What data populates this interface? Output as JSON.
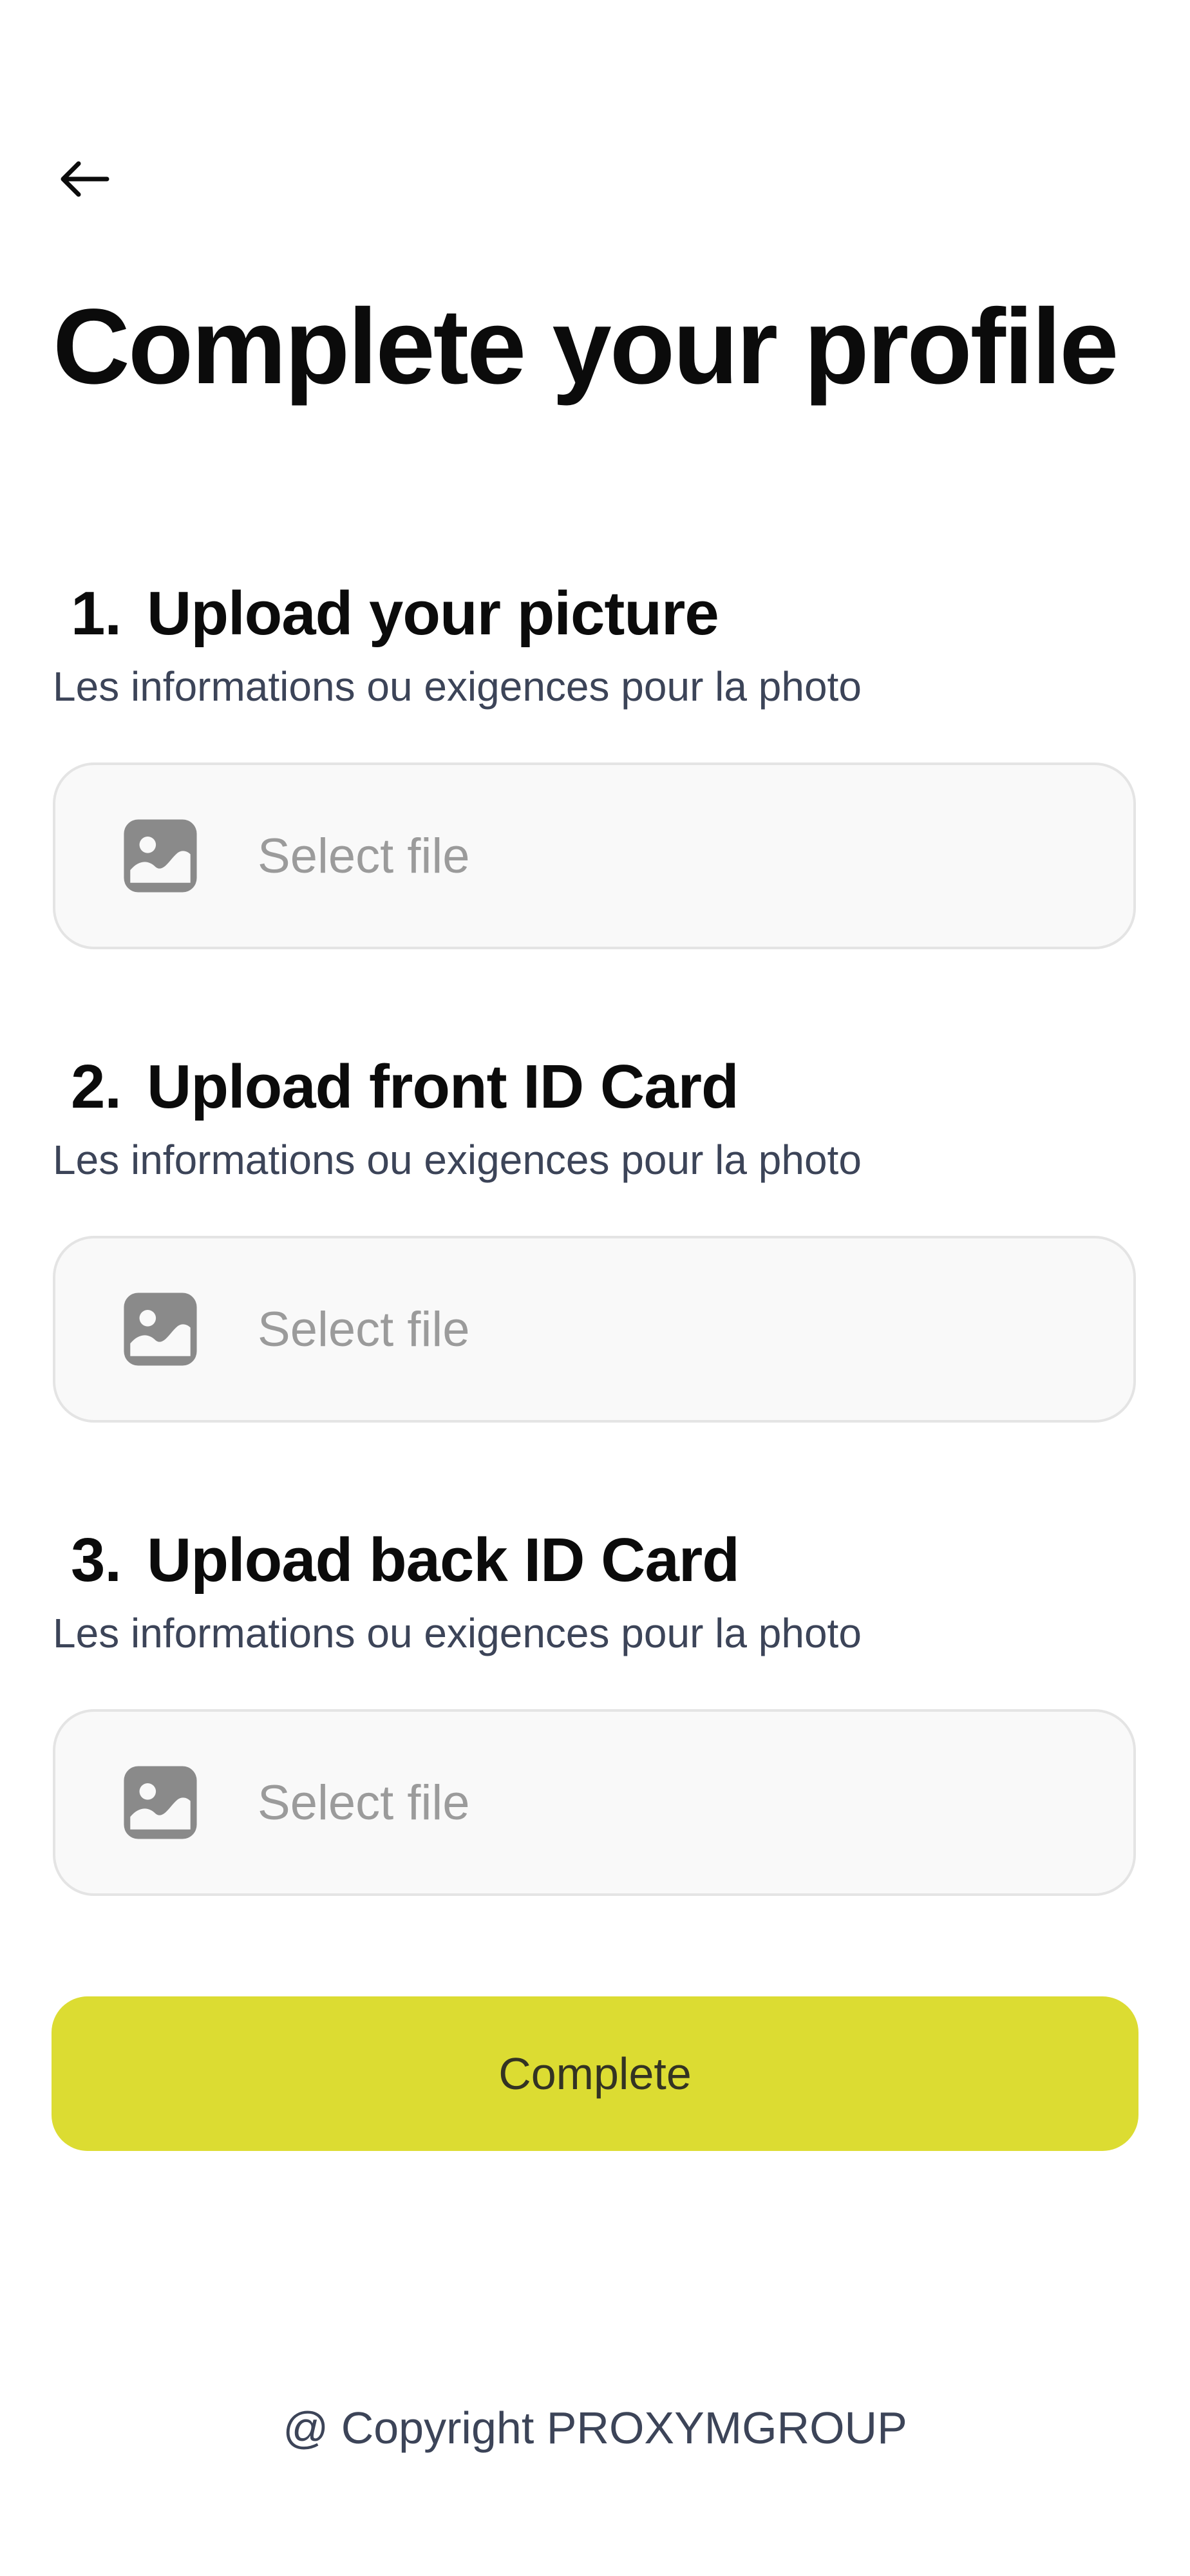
{
  "header": {
    "back_icon": "arrow-left-icon",
    "title": "Complete your profile"
  },
  "sections": [
    {
      "number": "1.",
      "title": "Upload your picture",
      "hint": "Les informations ou exigences pour la photo",
      "upload": {
        "icon": "image-icon",
        "label": "Select file"
      }
    },
    {
      "number": "2.",
      "title": "Upload front ID Card",
      "hint": "Les informations ou exigences pour la photo",
      "upload": {
        "icon": "image-icon",
        "label": "Select file"
      }
    },
    {
      "number": "3.",
      "title": "Upload back ID Card",
      "hint": "Les informations ou exigences pour la photo",
      "upload": {
        "icon": "image-icon",
        "label": "Select file"
      }
    }
  ],
  "actions": {
    "complete_label": "Complete"
  },
  "footer": {
    "copyright": "@ Copyright PROXYMGROUP"
  },
  "colors": {
    "accent": "#dcdc32",
    "text": "#0b0b0b",
    "muted": "#3c4458",
    "placeholder": "#9b9b9b",
    "field_bg": "#f9f9f9",
    "field_border": "#e4e4e4"
  }
}
